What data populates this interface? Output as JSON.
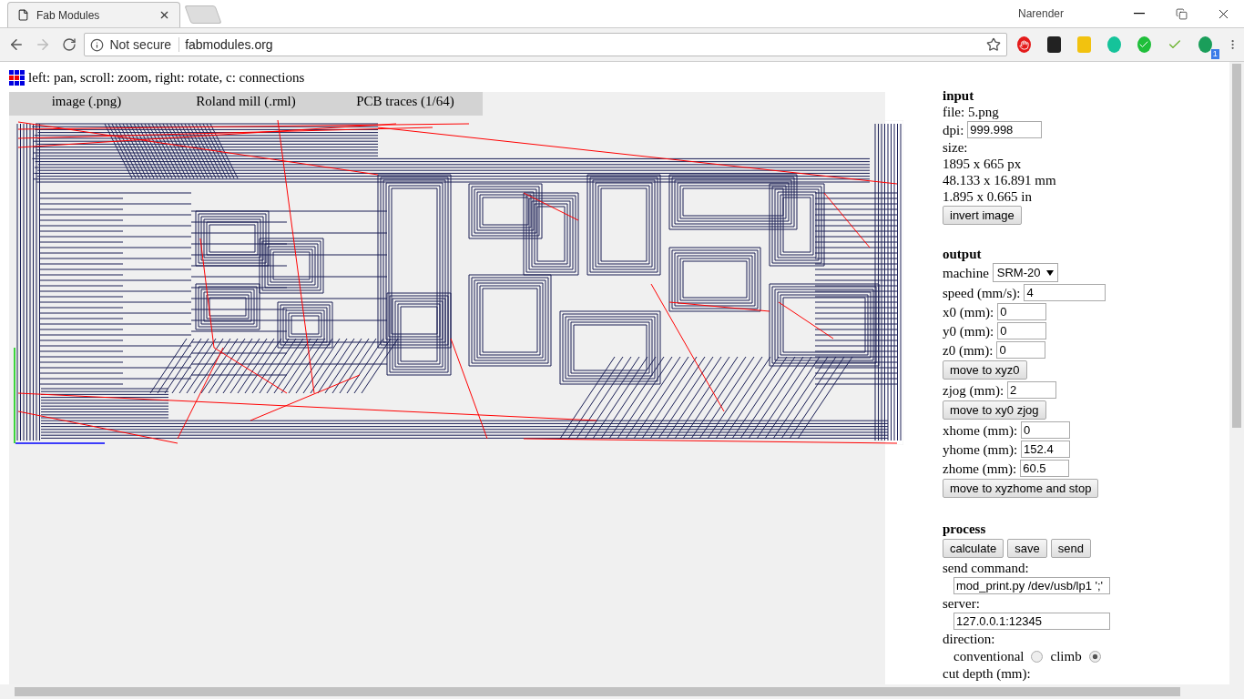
{
  "browser": {
    "tab_title": "Fab Modules",
    "security": "Not secure",
    "url": "fabmodules.org",
    "profile": "Narender",
    "extension_badge": "1"
  },
  "page": {
    "hint": "left: pan, scroll: zoom, right: rotate, c: connections",
    "menu": [
      "image (.png)",
      "Roland mill (.rml)",
      "PCB traces (1/64)"
    ]
  },
  "input": {
    "heading": "input",
    "file": "file: 5.png",
    "dpi_label": "dpi:",
    "dpi": "999.998",
    "size_label": "size:",
    "size_lines": [
      "1895 x 665 px",
      "48.133 x 16.891 mm",
      "1.895 x 0.665 in"
    ],
    "invert_button": "invert image"
  },
  "output": {
    "heading": "output",
    "machine_label": "machine",
    "machine": "SRM-20",
    "rows": [
      {
        "kind": "field",
        "label": "speed (mm/s):",
        "value": "4"
      },
      {
        "kind": "field",
        "label": "x0 (mm):",
        "value": "0"
      },
      {
        "kind": "field",
        "label": "y0 (mm):",
        "value": "0"
      },
      {
        "kind": "field",
        "label": "z0 (mm):",
        "value": "0"
      },
      {
        "kind": "button",
        "label": "move to xyz0"
      },
      {
        "kind": "field",
        "label": "zjog (mm):",
        "value": "2"
      },
      {
        "kind": "button",
        "label": "move to xy0 zjog"
      },
      {
        "kind": "field",
        "label": "xhome (mm):",
        "value": "0"
      },
      {
        "kind": "field",
        "label": "yhome (mm):",
        "value": "152.4"
      },
      {
        "kind": "field",
        "label": "zhome (mm):",
        "value": "60.5"
      },
      {
        "kind": "button",
        "label": "move to xyzhome and stop"
      }
    ]
  },
  "process": {
    "heading": "process",
    "buttons": [
      "calculate",
      "save",
      "send"
    ],
    "send_command_label": "send command:",
    "send_command": "mod_print.py /dev/usb/lp1 ';'",
    "server_label": "server:",
    "server": "127.0.0.1:12345",
    "direction_label": "direction:",
    "directions": [
      {
        "label": "conventional",
        "selected": false
      },
      {
        "label": "climb",
        "selected": true
      }
    ],
    "cut_depth_label": "cut depth (mm):"
  }
}
